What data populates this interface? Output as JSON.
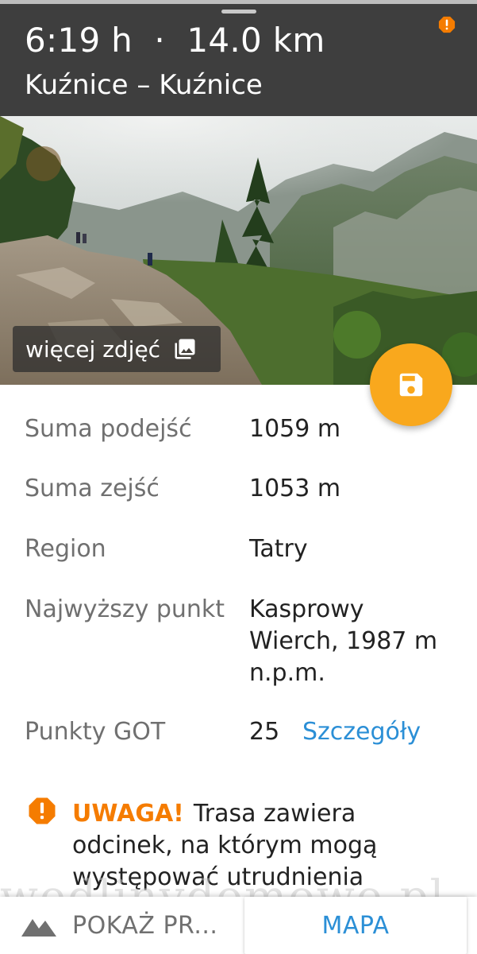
{
  "colors": {
    "header_bg": "#3e3e3e",
    "accent_orange": "#f9a81d",
    "warning_orange": "#f57c00",
    "link_blue": "#2b8fd6"
  },
  "header": {
    "title": "6:19 h  ·  14.0 km",
    "subtitle": "Kuźnice – Kuźnice",
    "alert_icon": "alert-octagon-icon"
  },
  "photo": {
    "more_photos_label": "więcej zdjęć",
    "gallery_icon": "image-gallery-icon"
  },
  "fab": {
    "icon": "save-icon"
  },
  "details": [
    {
      "label": "Suma podejść",
      "value": "1059 m"
    },
    {
      "label": "Suma zejść",
      "value": "1053 m"
    },
    {
      "label": "Region",
      "value": "Tatry"
    },
    {
      "label": "Najwyższy punkt",
      "value": "Kasprowy Wierch, 1987 m n.p.m."
    },
    {
      "label": "Punkty GOT",
      "value": "25"
    }
  ],
  "got_details_link": "Szczegóły",
  "warning": {
    "icon": "alert-octagon-icon",
    "tag": "UWAGA!",
    "text": "Trasa zawiera odcinek, na którym mogą występować utrudnienia"
  },
  "watermark": "wedlinydomowe.pl",
  "bottom_bar": {
    "profile_icon": "mountain-icon",
    "show_profile_label": "POKAŻ PR...",
    "map_label": "MAPA"
  }
}
